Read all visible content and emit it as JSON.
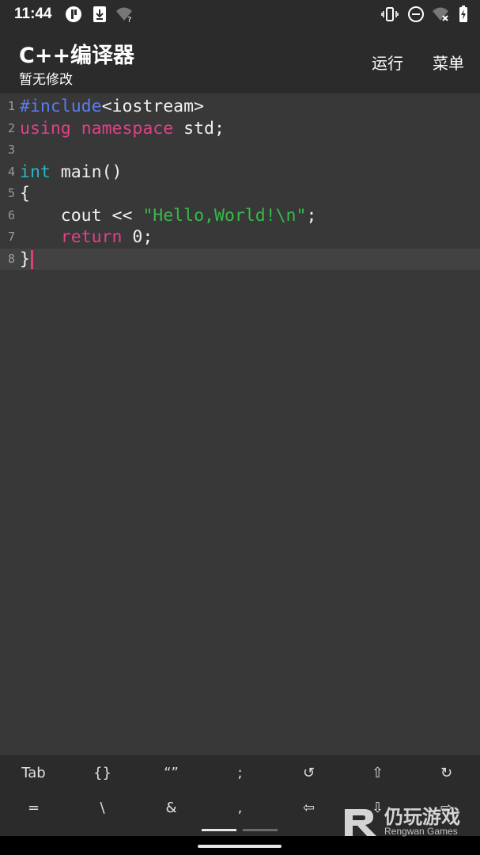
{
  "status": {
    "time": "11:44",
    "icons": [
      "notification-icon",
      "download-icon",
      "wifi-question-icon",
      "vibrate-icon",
      "dnd-icon",
      "wifi-off-icon",
      "battery-charging-icon"
    ]
  },
  "app_bar": {
    "title": "C++编译器",
    "subtitle": "暂无修改",
    "run_label": "运行",
    "menu_label": "菜单"
  },
  "editor": {
    "line_numbers": [
      "1",
      "2",
      "3",
      "4",
      "5",
      "6",
      "7",
      "8"
    ],
    "lines": [
      [
        {
          "t": "#include",
          "c": "pre"
        },
        {
          "t": "<iostream>",
          "c": ""
        }
      ],
      [
        {
          "t": "using",
          "c": "kw"
        },
        {
          "t": " ",
          "c": ""
        },
        {
          "t": "namespace",
          "c": "kw"
        },
        {
          "t": " std;",
          "c": ""
        }
      ],
      [],
      [
        {
          "t": "int",
          "c": "type"
        },
        {
          "t": " main()",
          "c": ""
        }
      ],
      [
        {
          "t": "{",
          "c": ""
        }
      ],
      [
        {
          "t": "    cout << ",
          "c": ""
        },
        {
          "t": "\"Hello,World!\\n\"",
          "c": "str"
        },
        {
          "t": ";",
          "c": ""
        }
      ],
      [
        {
          "t": "    ",
          "c": ""
        },
        {
          "t": "return",
          "c": "kw"
        },
        {
          "t": " 0;",
          "c": ""
        }
      ],
      [
        {
          "t": "}",
          "c": ""
        }
      ]
    ],
    "current_line": 8
  },
  "keybar": {
    "row1": [
      "Tab",
      "{}",
      "“”",
      ";",
      "↺",
      "⇧",
      "↻"
    ],
    "row2": [
      "=",
      "\\",
      "&",
      ",",
      "⇦",
      "⇩",
      "⇨"
    ]
  },
  "watermark": {
    "title": "仍玩游戏",
    "subtitle": "Rengwan Games"
  }
}
